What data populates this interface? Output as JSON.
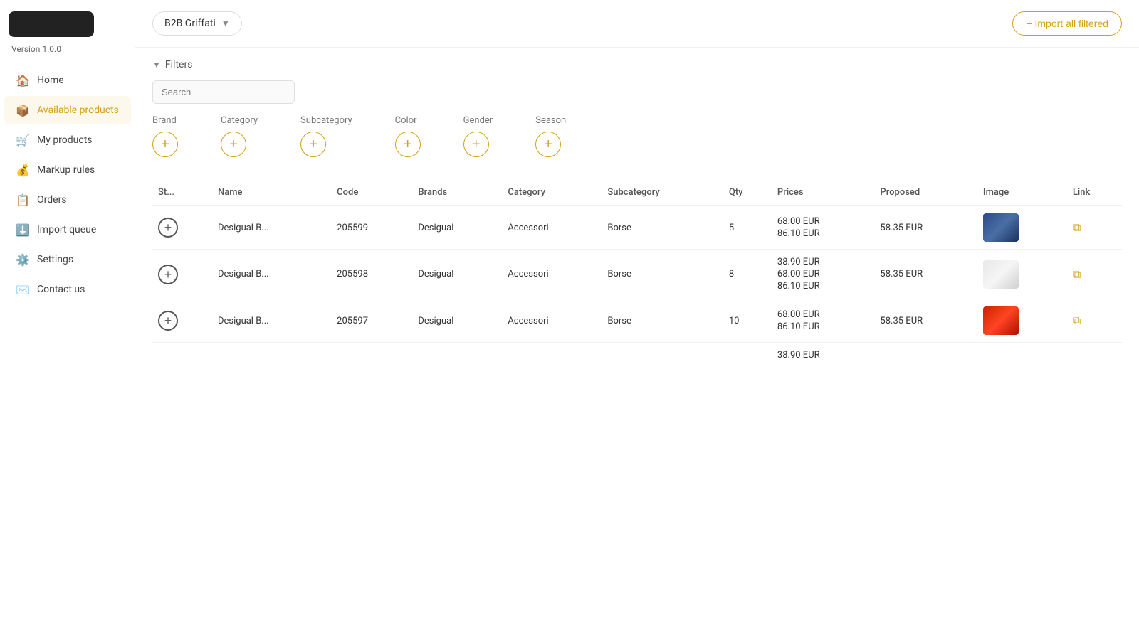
{
  "sidebar": {
    "logo_alt": "Logo",
    "version": "Version 1.0.0",
    "items": [
      {
        "id": "home",
        "label": "Home",
        "icon": "🏠",
        "active": false
      },
      {
        "id": "available-products",
        "label": "Available products",
        "icon": "📦",
        "active": true
      },
      {
        "id": "my-products",
        "label": "My products",
        "icon": "🛒",
        "active": false
      },
      {
        "id": "markup-rules",
        "label": "Markup rules",
        "icon": "💰",
        "active": false
      },
      {
        "id": "orders",
        "label": "Orders",
        "icon": "📋",
        "active": false
      },
      {
        "id": "import-queue",
        "label": "Import queue",
        "icon": "⬇️",
        "active": false
      },
      {
        "id": "settings",
        "label": "Settings",
        "icon": "⚙️",
        "active": false
      },
      {
        "id": "contact-us",
        "label": "Contact us",
        "icon": "✉️",
        "active": false
      }
    ]
  },
  "topbar": {
    "store_name": "B2B Griffati",
    "import_button": "+ Import all filtered"
  },
  "filters": {
    "toggle_label": "Filters",
    "search_placeholder": "Search",
    "items": [
      {
        "id": "brand",
        "label": "Brand"
      },
      {
        "id": "category",
        "label": "Category"
      },
      {
        "id": "subcategory",
        "label": "Subcategory"
      },
      {
        "id": "color",
        "label": "Color"
      },
      {
        "id": "gender",
        "label": "Gender"
      },
      {
        "id": "season",
        "label": "Season"
      }
    ]
  },
  "table": {
    "columns": [
      {
        "id": "status",
        "label": "St..."
      },
      {
        "id": "name",
        "label": "Name"
      },
      {
        "id": "code",
        "label": "Code"
      },
      {
        "id": "brands",
        "label": "Brands"
      },
      {
        "id": "category",
        "label": "Category"
      },
      {
        "id": "subcategory",
        "label": "Subcategory"
      },
      {
        "id": "qty",
        "label": "Qty"
      },
      {
        "id": "prices",
        "label": "Prices"
      },
      {
        "id": "proposed",
        "label": "Proposed"
      },
      {
        "id": "image",
        "label": "Image"
      },
      {
        "id": "link",
        "label": "Link"
      }
    ],
    "rows": [
      {
        "id": 1,
        "name": "Desigual B...",
        "code": "205599",
        "brands": "Desigual",
        "category": "Accessori",
        "subcategory": "Borse",
        "qty": "5",
        "prices": [
          "68.00 EUR",
          "86.10 EUR"
        ],
        "proposed": "58.35 EUR",
        "image_type": "blue",
        "has_link": true
      },
      {
        "id": 2,
        "name": "Desigual B...",
        "code": "205598",
        "brands": "Desigual",
        "category": "Accessori",
        "subcategory": "Borse",
        "qty": "8",
        "prices": [
          "38.90 EUR",
          "68.00 EUR",
          "86.10 EUR"
        ],
        "proposed": "58.35 EUR",
        "image_type": "white",
        "has_link": true
      },
      {
        "id": 3,
        "name": "Desigual B...",
        "code": "205597",
        "brands": "Desigual",
        "category": "Accessori",
        "subcategory": "Borse",
        "qty": "10",
        "prices": [
          "68.00 EUR",
          "86.10 EUR"
        ],
        "proposed": "58.35 EUR",
        "image_type": "red",
        "has_link": true
      },
      {
        "id": 4,
        "name": "",
        "code": "",
        "brands": "",
        "category": "",
        "subcategory": "",
        "qty": "",
        "prices": [
          "38.90 EUR"
        ],
        "proposed": "",
        "image_type": null,
        "has_link": false
      }
    ]
  }
}
